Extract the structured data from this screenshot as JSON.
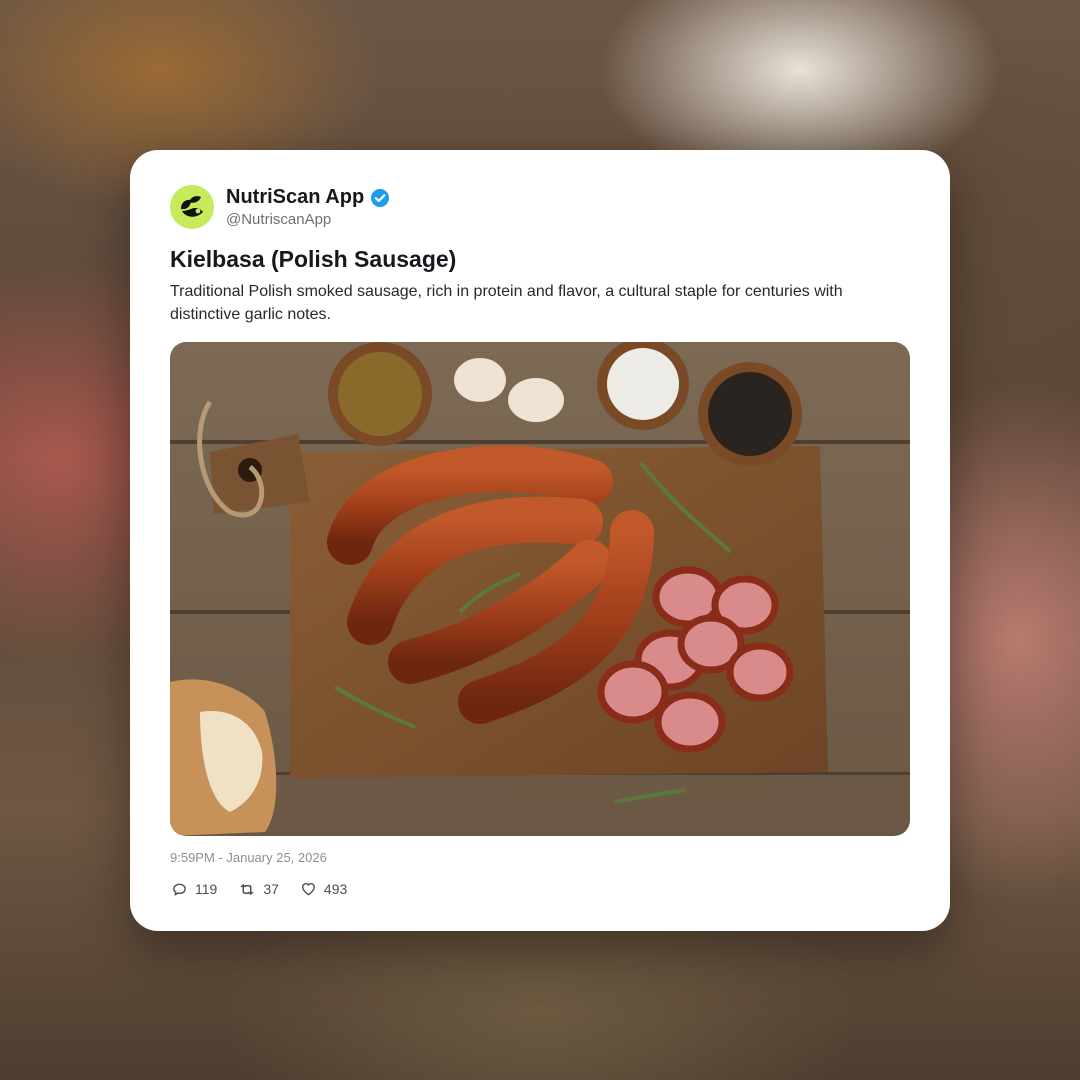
{
  "post": {
    "account_name": "NutriScan App",
    "handle": "@NutriscanApp",
    "verified": true,
    "avatar_icon": "leaf-logo-icon",
    "avatar_color": "#c6ea5a",
    "title": "Kielbasa (Polish Sausage)",
    "description": "Traditional Polish smoked sausage, rich in protein and flavor, a cultural staple for centuries with distinctive garlic notes.",
    "image_icon": "kielbasa-photo",
    "timestamp": "9:59PM - January 25, 2026",
    "stats": {
      "replies": "119",
      "retweets": "37",
      "likes": "493"
    }
  },
  "colors": {
    "card_background": "#ffffff",
    "verified_badge": "#1d9bf0",
    "text_primary": "#15181c",
    "text_secondary": "#6b7177"
  }
}
